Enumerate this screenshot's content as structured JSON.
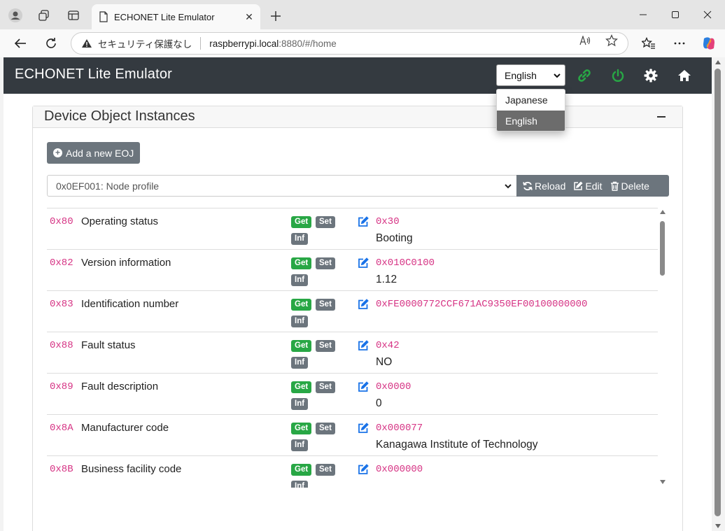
{
  "browser": {
    "tab_title": "ECHONET Lite Emulator",
    "address": {
      "security_warning": "セキュリティ保護なし",
      "host": "raspberrypi.local",
      "path": ":8880/#/home"
    }
  },
  "app": {
    "title": "ECHONET Lite Emulator",
    "language": {
      "selected": "English",
      "options": [
        "Japanese",
        "English"
      ]
    },
    "colors": {
      "header_bg": "#343a40",
      "link_icon": "#28a745",
      "power_icon": "#28a745",
      "epc_text": "#d63384",
      "get_badge": "#28a745"
    }
  },
  "card": {
    "title": "Device Object Instances",
    "add_button": "Add a new EOJ",
    "eoj_selected": "0x0EF001: Node profile",
    "reload_label": "Reload",
    "edit_label": "Edit",
    "delete_label": "Delete"
  },
  "properties": [
    {
      "epc": "0x80",
      "name": "Operating status",
      "get": "Get",
      "set": "Set",
      "inf": "Inf",
      "edt": "0x30",
      "value": "Booting"
    },
    {
      "epc": "0x82",
      "name": "Version information",
      "get": "Get",
      "set": "Set",
      "inf": "Inf",
      "edt": "0x010C0100",
      "value": "1.12"
    },
    {
      "epc": "0x83",
      "name": "Identification number",
      "get": "Get",
      "set": "Set",
      "inf": "Inf",
      "edt": "0xFE0000772CCF671AC9350EF00100000000",
      "value": ""
    },
    {
      "epc": "0x88",
      "name": "Fault status",
      "get": "Get",
      "set": "Set",
      "inf": "Inf",
      "edt": "0x42",
      "value": "NO"
    },
    {
      "epc": "0x89",
      "name": "Fault description",
      "get": "Get",
      "set": "Set",
      "inf": "Inf",
      "edt": "0x0000",
      "value": "0"
    },
    {
      "epc": "0x8A",
      "name": "Manufacturer code",
      "get": "Get",
      "set": "Set",
      "inf": "Inf",
      "edt": "0x000077",
      "value": "Kanagawa Institute of Technology"
    },
    {
      "epc": "0x8B",
      "name": "Business facility code",
      "get": "Get",
      "set": "Set",
      "inf": "Inf",
      "edt": "0x000000",
      "value": ""
    }
  ]
}
